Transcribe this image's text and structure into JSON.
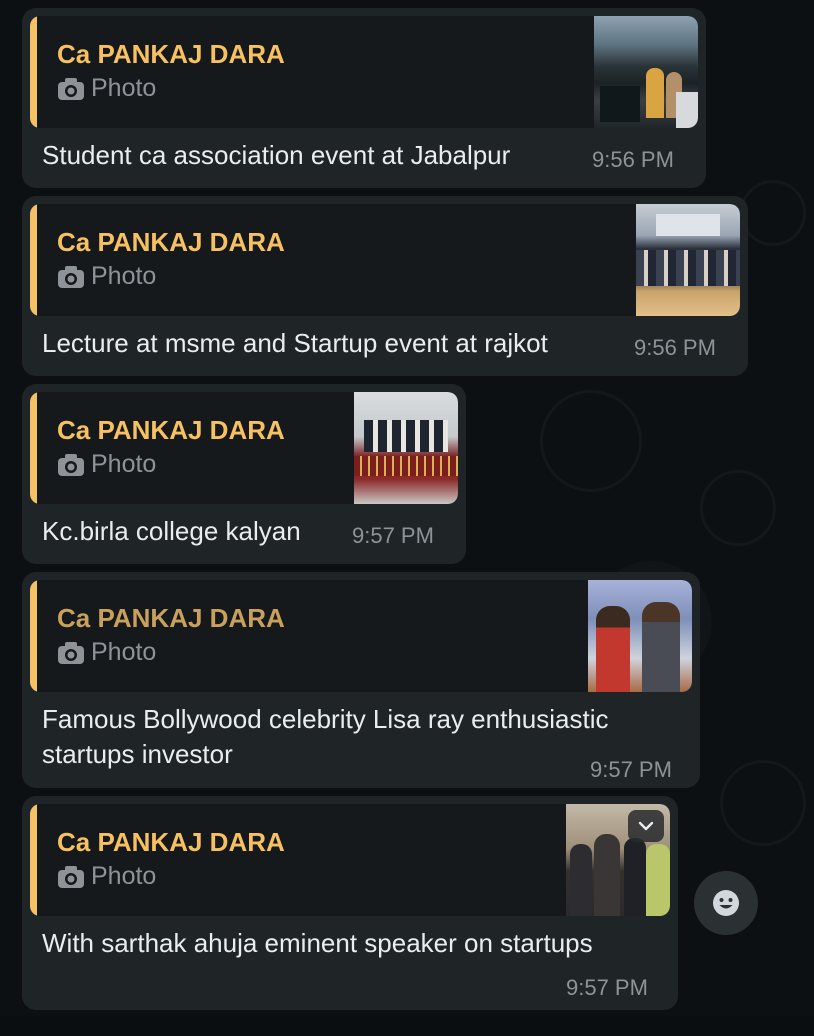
{
  "messages": [
    {
      "quote_author": "Ca PANKAJ DARA",
      "quote_kind": "Photo",
      "text": "Student ca association event at Jabalpur",
      "time": "9:56 PM"
    },
    {
      "quote_author": "Ca PANKAJ DARA",
      "quote_kind": "Photo",
      "text": "Lecture at msme and Startup event at rajkot",
      "time": "9:56 PM"
    },
    {
      "quote_author": "Ca PANKAJ DARA",
      "quote_kind": "Photo",
      "text": "Kc.birla college kalyan",
      "time": "9:57 PM"
    },
    {
      "quote_author": "Ca PANKAJ DARA",
      "quote_kind": "Photo",
      "text": "Famous Bollywood celebrity Lisa ray enthusiastic startups investor",
      "time": "9:57 PM"
    },
    {
      "quote_author": "Ca PANKAJ DARA",
      "quote_kind": "Photo",
      "text": "With sarthak ahuja eminent speaker on startups",
      "time": "9:57 PM"
    }
  ],
  "icons": {
    "camera": "camera-icon",
    "dropdown": "chevron-down-icon",
    "emoji": "emoji-icon"
  },
  "colors": {
    "accent_author": "#f7c061",
    "bubble": "#1f2426",
    "quote_bg": "#15191b",
    "text": "#e9edef",
    "meta": "#8d9396"
  }
}
